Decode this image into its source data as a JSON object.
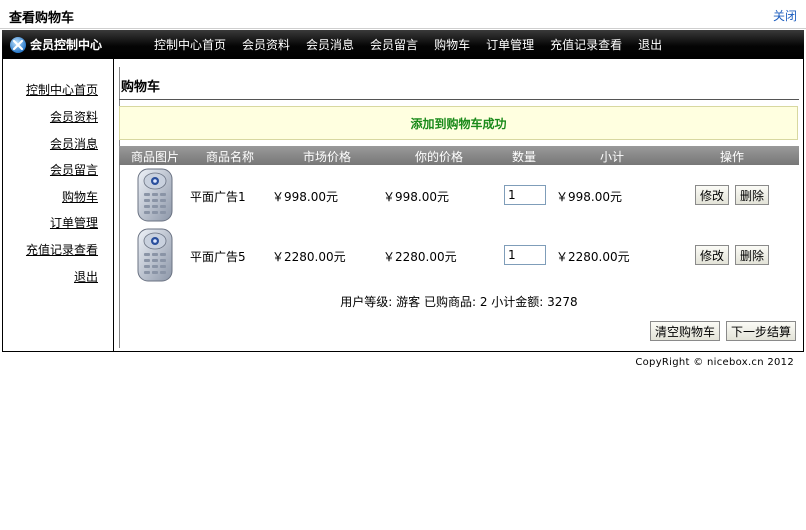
{
  "window": {
    "title": "查看购物车",
    "close_label": "关闭"
  },
  "navbar": {
    "brand": "会员控制中心",
    "items": [
      "控制中心首页",
      "会员资料",
      "会员消息",
      "会员留言",
      "购物车",
      "订单管理",
      "充值记录查看",
      "退出"
    ]
  },
  "sidebar": {
    "items": [
      "控制中心首页",
      "会员资料",
      "会员消息",
      "会员留言",
      "购物车",
      "订单管理",
      "充值记录查看",
      "退出"
    ]
  },
  "cart": {
    "title": "购物车",
    "success_message": "添加到购物车成功",
    "columns": [
      "商品图片",
      "商品名称",
      "市场价格",
      "你的价格",
      "数量",
      "小计",
      "操作"
    ],
    "rows": [
      {
        "name": "平面广告1",
        "market_price": "￥998.00元",
        "your_price": "￥998.00元",
        "quantity": "1",
        "subtotal": "￥998.00元",
        "edit": "修改",
        "delete": "删除"
      },
      {
        "name": "平面广告5",
        "market_price": "￥2280.00元",
        "your_price": "￥2280.00元",
        "quantity": "1",
        "subtotal": "￥2280.00元",
        "edit": "修改",
        "delete": "删除"
      }
    ],
    "summary": "用户等级: 游客 已购商品: 2 小计金额: 3278",
    "clear_button": "清空购物车",
    "checkout_button": "下一步结算"
  },
  "footer": {
    "copyright": "CopyRight © nicebox.cn 2012"
  }
}
